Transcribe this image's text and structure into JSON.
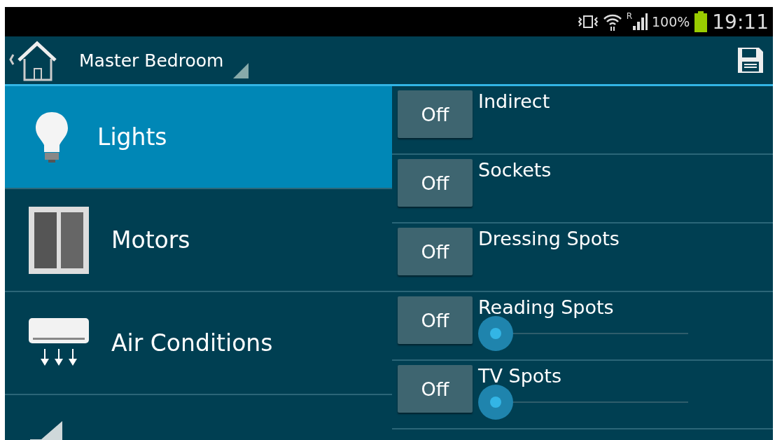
{
  "status_bar": {
    "roaming": "R",
    "battery": "100%",
    "time": "19:11"
  },
  "action_bar": {
    "title": "Master Bedroom"
  },
  "categories": [
    {
      "label": "Lights",
      "selected": true
    },
    {
      "label": "Motors",
      "selected": false
    },
    {
      "label": "Air Conditions",
      "selected": false
    },
    {
      "selected": false
    }
  ],
  "devices": [
    {
      "kind": "switch",
      "name": "Indirect",
      "button": "Off"
    },
    {
      "kind": "switch",
      "name": "Sockets",
      "button": "Off"
    },
    {
      "kind": "switch",
      "name": "Dressing Spots",
      "button": "Off"
    },
    {
      "kind": "dimmer",
      "name": "Reading Spots",
      "button": "Off",
      "level": 0
    },
    {
      "kind": "dimmer",
      "name": "TV Spots",
      "button": "Off",
      "level": 0
    }
  ]
}
